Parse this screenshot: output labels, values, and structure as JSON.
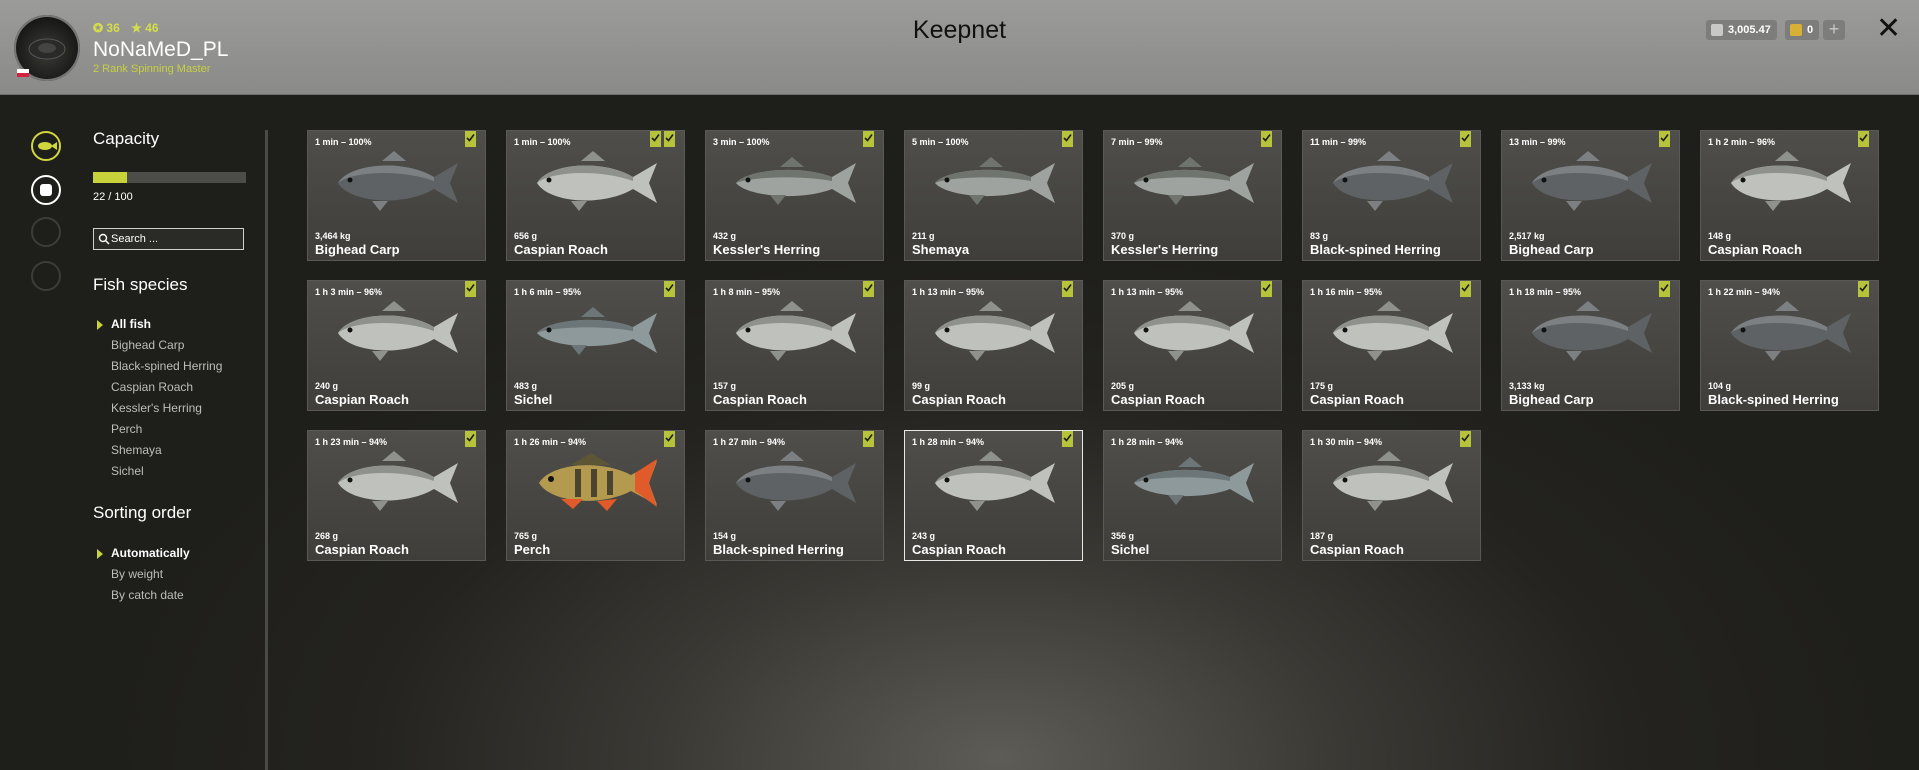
{
  "player": {
    "level": "36",
    "rank_points": "46",
    "name": "NoNaMeD_PL",
    "rank": "2 Rank Spinning Master"
  },
  "header": {
    "title": "Keepnet",
    "silver": "3,005.47",
    "gold": "0"
  },
  "sidebar": {
    "capacity_title": "Capacity",
    "capacity_text": "22 / 100",
    "capacity_fraction": 0.22,
    "search_placeholder": "Search ...",
    "species_title": "Fish species",
    "species": [
      "All fish",
      "Bighead Carp",
      "Black-spined Herring",
      "Caspian Roach",
      "Kessler's Herring",
      "Perch",
      "Shemaya",
      "Sichel"
    ],
    "sorting_title": "Sorting order",
    "sorting": [
      "Automatically",
      "By weight",
      "By catch date"
    ]
  },
  "fish": [
    {
      "time": "1 min – 100%",
      "weight": "3,464 kg",
      "name": "Bighead Carp",
      "kind": "carp",
      "badges": 1
    },
    {
      "time": "1 min – 100%",
      "weight": "656 g",
      "name": "Caspian Roach",
      "kind": "roach",
      "badges": 2
    },
    {
      "time": "3 min – 100%",
      "weight": "432 g",
      "name": "Kessler's Herring",
      "kind": "herring",
      "badges": 1
    },
    {
      "time": "5 min – 100%",
      "weight": "211 g",
      "name": "Shemaya",
      "kind": "herring",
      "badges": 1
    },
    {
      "time": "7 min – 99%",
      "weight": "370 g",
      "name": "Kessler's Herring",
      "kind": "herring",
      "badges": 1
    },
    {
      "time": "11 min – 99%",
      "weight": "83 g",
      "name": "Black-spined Herring",
      "kind": "carp",
      "badges": 1
    },
    {
      "time": "13 min – 99%",
      "weight": "2,517 kg",
      "name": "Bighead Carp",
      "kind": "carp",
      "badges": 1
    },
    {
      "time": "1 h 2 min – 96%",
      "weight": "148 g",
      "name": "Caspian Roach",
      "kind": "roach",
      "badges": 1
    },
    {
      "time": "1 h 3 min – 96%",
      "weight": "240 g",
      "name": "Caspian Roach",
      "kind": "roach",
      "badges": 1
    },
    {
      "time": "1 h 6 min – 95%",
      "weight": "483 g",
      "name": "Sichel",
      "kind": "sichel",
      "badges": 1
    },
    {
      "time": "1 h 8 min – 95%",
      "weight": "157 g",
      "name": "Caspian Roach",
      "kind": "roach",
      "badges": 1
    },
    {
      "time": "1 h 13 min – 95%",
      "weight": "99 g",
      "name": "Caspian Roach",
      "kind": "roach",
      "badges": 1
    },
    {
      "time": "1 h 13 min – 95%",
      "weight": "205 g",
      "name": "Caspian Roach",
      "kind": "roach",
      "badges": 1
    },
    {
      "time": "1 h 16 min – 95%",
      "weight": "175 g",
      "name": "Caspian Roach",
      "kind": "roach",
      "badges": 1
    },
    {
      "time": "1 h 18 min – 95%",
      "weight": "3,133 kg",
      "name": "Bighead Carp",
      "kind": "carp",
      "badges": 1
    },
    {
      "time": "1 h 22 min – 94%",
      "weight": "104 g",
      "name": "Black-spined Herring",
      "kind": "carp",
      "badges": 1
    },
    {
      "time": "1 h 23 min – 94%",
      "weight": "268 g",
      "name": "Caspian Roach",
      "kind": "roach",
      "badges": 1
    },
    {
      "time": "1 h 26 min – 94%",
      "weight": "765 g",
      "name": "Perch",
      "kind": "perch",
      "badges": 1
    },
    {
      "time": "1 h 27 min – 94%",
      "weight": "154 g",
      "name": "Black-spined Herring",
      "kind": "carp",
      "badges": 1
    },
    {
      "time": "1 h 28 min – 94%",
      "weight": "243 g",
      "name": "Caspian Roach",
      "kind": "roach",
      "badges": 1,
      "active": true
    },
    {
      "time": "1 h 28 min – 94%",
      "weight": "356 g",
      "name": "Sichel",
      "kind": "sichel",
      "badges": 0
    },
    {
      "time": "1 h 30 min – 94%",
      "weight": "187 g",
      "name": "Caspian Roach",
      "kind": "roach",
      "badges": 1
    }
  ],
  "colors": {
    "accent": "#c8d23a",
    "header_bg": "#8f8f8d"
  }
}
